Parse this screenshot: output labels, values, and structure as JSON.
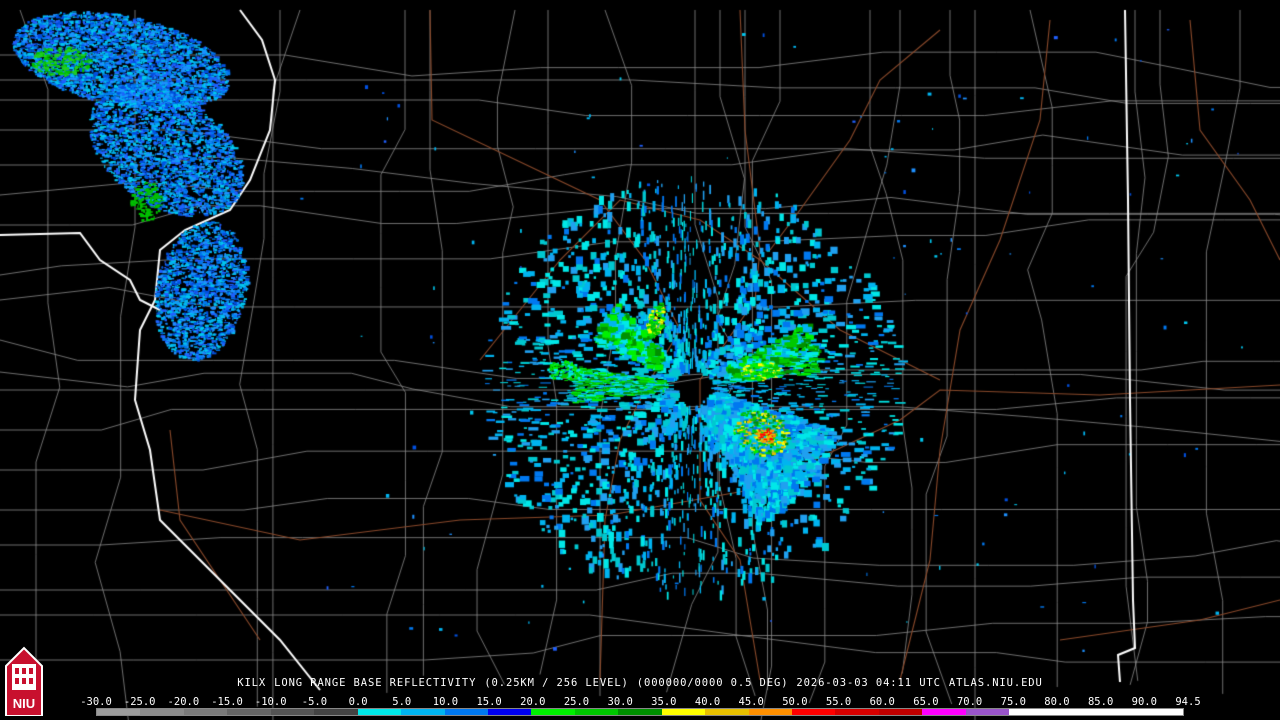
{
  "header": {
    "station": "KILX",
    "product": "LONG RANGE BASE REFLECTIVITY",
    "resolution": "(0.25KM / 256 LEVEL)",
    "volume": "(000000/0000 0.5 DEG)",
    "timestamp": "2026-03-03 04:11 UTC",
    "source": "ATLAS.NIU.EDU"
  },
  "logo": {
    "icon": "niu-logo-icon",
    "text": "NIU"
  },
  "color_scale": {
    "labels": [
      "-30.0",
      "-25.0",
      "-20.0",
      "-15.0",
      "-10.0",
      "-5.0",
      "0.0",
      "5.0",
      "10.0",
      "15.0",
      "20.0",
      "25.0",
      "30.0",
      "35.0",
      "40.0",
      "45.0",
      "50.0",
      "55.0",
      "60.0",
      "65.0",
      "70.0",
      "75.0",
      "80.0",
      "85.0",
      "90.0",
      "94.5"
    ],
    "colors": [
      "#9c9c9c",
      "#8a8a8a",
      "#7a7a7a",
      "#666666",
      "#555555",
      "#444444",
      "#00e8e8",
      "#00b4f0",
      "#0078f0",
      "#0000f0",
      "#00f000",
      "#00c800",
      "#009000",
      "#ffff00",
      "#e7c000",
      "#ff9000",
      "#ff0000",
      "#d60000",
      "#c00000",
      "#ff00ff",
      "#9955c9",
      "#ffffff",
      "#ffffff",
      "#ffffff",
      "#ffffff"
    ]
  },
  "map": {
    "background": "#000000",
    "county_line_color": "#8c8c8c",
    "state_line_color": "#ffffff",
    "highway_color": "#8b4a2b"
  }
}
